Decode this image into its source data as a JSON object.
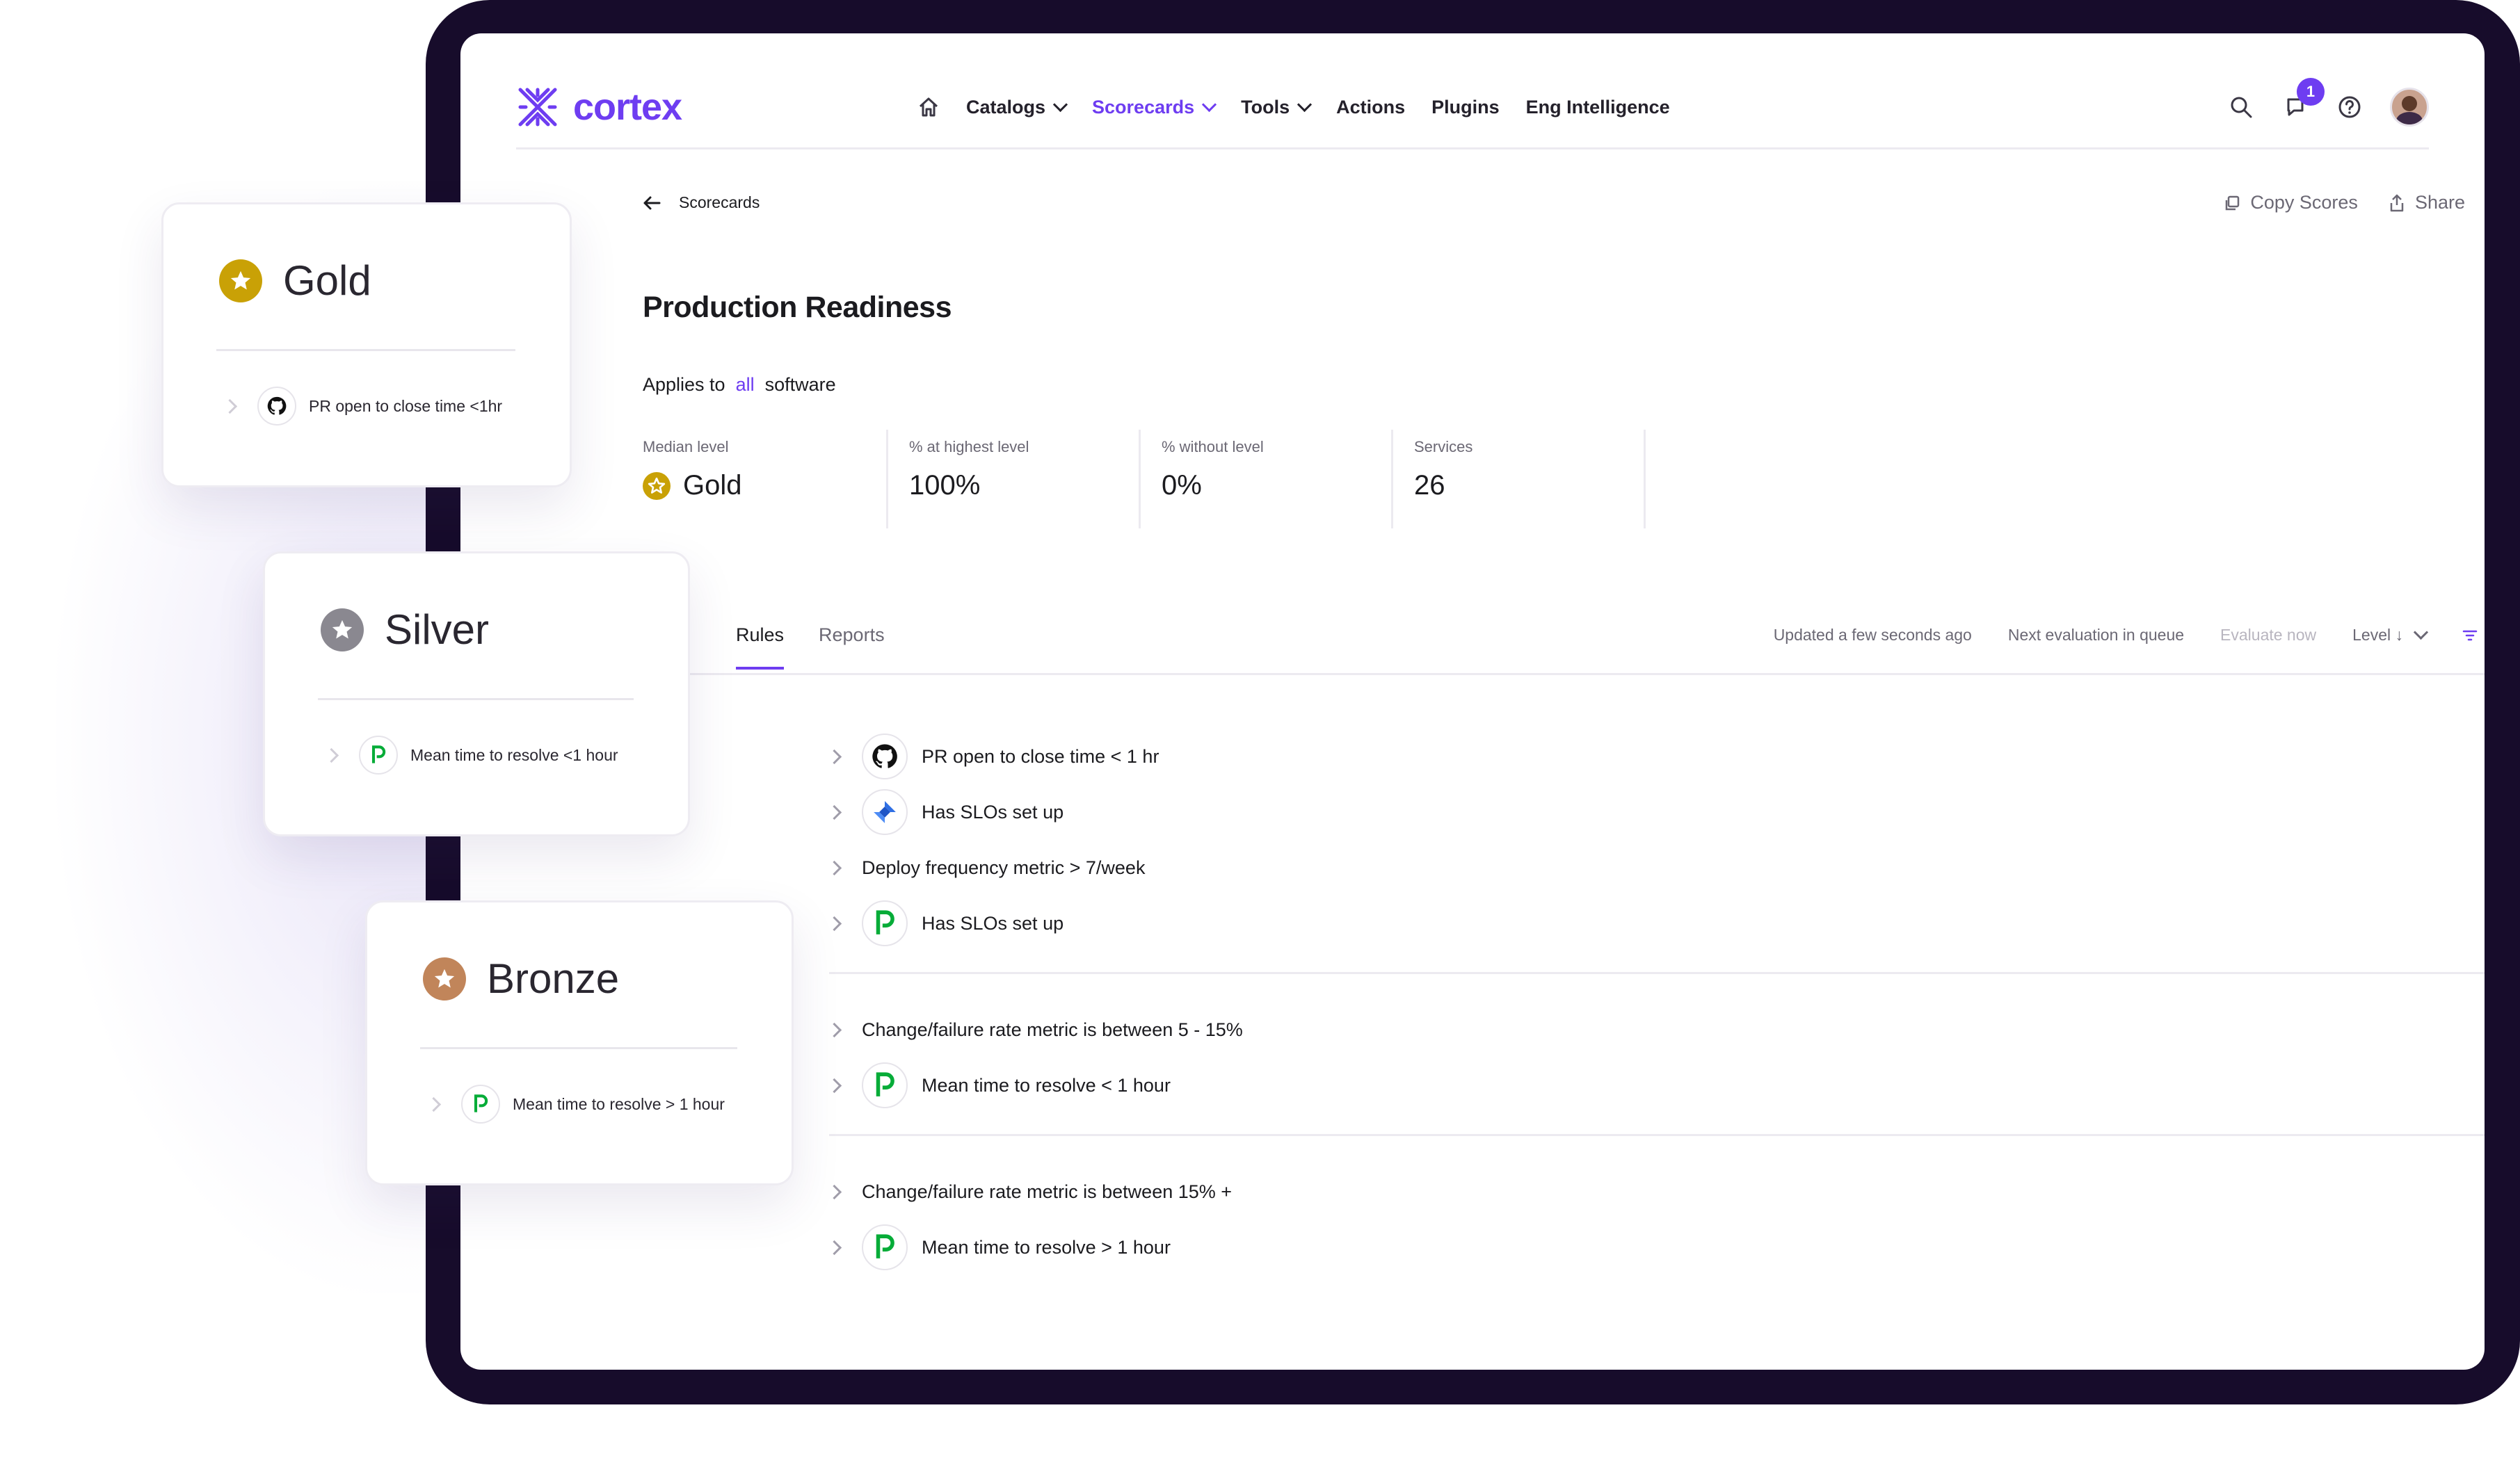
{
  "colors": {
    "accent": "#6e3df1",
    "frame": "#170c2b",
    "gold": "#c9a106",
    "silver": "#8a8890",
    "bronze": "#c1855a",
    "pagerduty": "#06ac38",
    "jira": "#2f6fe4"
  },
  "header": {
    "logo": "cortex",
    "nav": [
      {
        "label": "Catalogs",
        "dropdown": true
      },
      {
        "label": "Scorecards",
        "dropdown": true,
        "active": true
      },
      {
        "label": "Tools",
        "dropdown": true
      },
      {
        "label": "Actions"
      },
      {
        "label": "Plugins"
      },
      {
        "label": "Eng Intelligence"
      }
    ],
    "notifications_count": "1"
  },
  "breadcrumb": "Scorecards",
  "actions": {
    "copy": "Copy Scores",
    "share": "Share"
  },
  "title": "Production Readiness",
  "applies": {
    "prefix": "Applies to",
    "link": "all",
    "suffix": "software"
  },
  "stats": [
    {
      "label": "Median level",
      "value": "Gold"
    },
    {
      "label": "% at highest level",
      "value": "100%"
    },
    {
      "label": "% without level",
      "value": "0%"
    },
    {
      "label": "Services",
      "value": "26"
    }
  ],
  "tabs": [
    {
      "label": "Rules",
      "active": true
    },
    {
      "label": "Reports"
    }
  ],
  "status": {
    "updated": "Updated a few seconds ago",
    "next": "Next evaluation in  queue",
    "evaluate": "Evaluate now",
    "sort": "Level ↓"
  },
  "rule_groups": [
    [
      {
        "icon": "github-icon",
        "label": "PR open to close time < 1 hr"
      },
      {
        "icon": "jira-icon",
        "label": "Has SLOs set up"
      },
      {
        "icon": "",
        "label": "Deploy frequency metric > 7/week"
      },
      {
        "icon": "pagerduty-icon",
        "label": "Has SLOs set up"
      }
    ],
    [
      {
        "icon": "",
        "label": "Change/failure rate metric is between 5 - 15%"
      },
      {
        "icon": "pagerduty-icon",
        "label": "Mean time to resolve < 1 hour"
      }
    ],
    [
      {
        "icon": "",
        "label": "Change/failure rate metric is between 15% +"
      },
      {
        "icon": "pagerduty-icon",
        "label": "Mean time to resolve > 1 hour"
      }
    ]
  ],
  "cards": {
    "gold": {
      "title": "Gold",
      "rule": "PR open to close time <1hr"
    },
    "silver": {
      "title": "Silver",
      "rule": "Mean time to resolve <1 hour"
    },
    "bronze": {
      "title": "Bronze",
      "rule": "Mean time to resolve > 1 hour"
    }
  }
}
